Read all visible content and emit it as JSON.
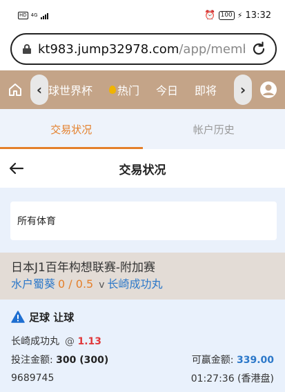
{
  "status_bar": {
    "network": "4G",
    "hd_label": "HD",
    "battery": "100",
    "time": "13:32"
  },
  "browser": {
    "url_host": "kt983.jump32978.com",
    "url_path": "/app/memb"
  },
  "nav": {
    "items": [
      {
        "label": "球世界杯"
      },
      {
        "label": "热门"
      },
      {
        "label": "今日"
      },
      {
        "label": "即将"
      }
    ],
    "accent": "#c4a488"
  },
  "tabs": {
    "active": "交易状况",
    "inactive": "帐户历史"
  },
  "page_title": "交易状况",
  "filter": {
    "label": "所有体育"
  },
  "match": {
    "league": "日本J1百年构想联赛-附加赛",
    "home": "水户蜀葵",
    "handicap": "0 / 0.5",
    "vs": "v",
    "away": "长崎成功丸"
  },
  "bet": {
    "sport_type": "足球 让球",
    "selection": "长崎成功丸",
    "at_symbol": "@",
    "odds": "1.13",
    "stake_label": "投注金额:",
    "stake_value": "300 (300)",
    "win_label": "可赢金额:",
    "win_value": "339.00",
    "ticket_id": "9689745",
    "time": "01:27:36 (香港盘)"
  },
  "colors": {
    "orange": "#e47f2a",
    "blue": "#2c78c9",
    "red": "#e0383a"
  }
}
